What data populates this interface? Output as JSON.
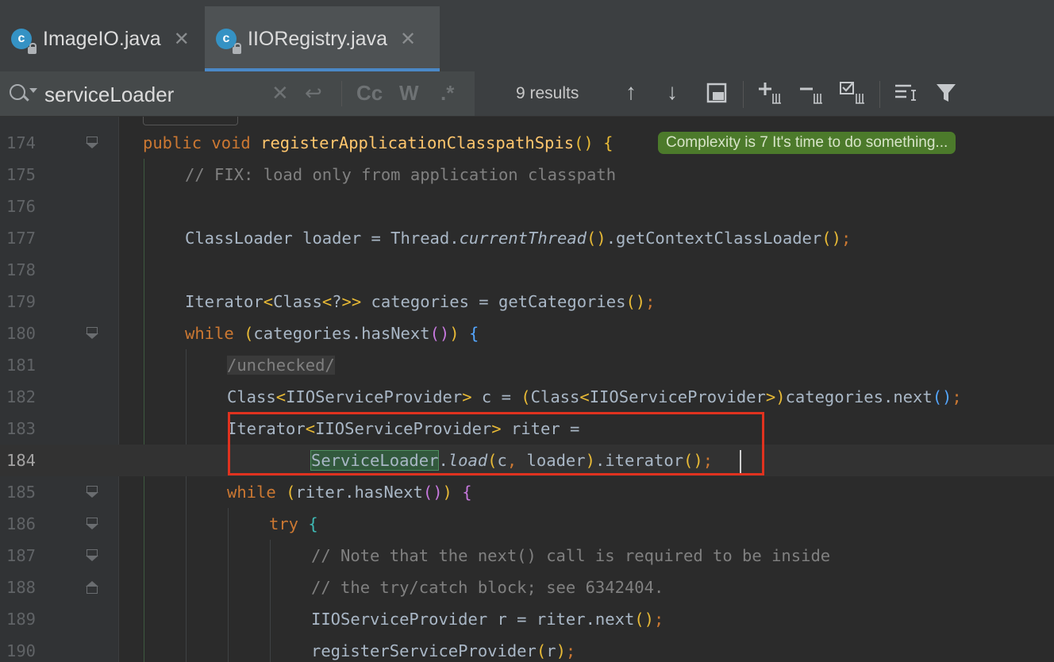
{
  "tabs": [
    {
      "label": "ImageIO.java",
      "icon": "java-class-icon",
      "close": "✕",
      "active": false
    },
    {
      "label": "IIORegistry.java",
      "icon": "java-class-icon",
      "close": "✕",
      "active": true
    }
  ],
  "find": {
    "query": "serviceLoader",
    "clear_glyph": "✕",
    "newline_glyph": "↩",
    "match_case_label": "Cc",
    "words_label": "W",
    "regex_label": ".*",
    "results_label": "9 results",
    "prev_glyph": "↑",
    "next_glyph": "↓"
  },
  "editor": {
    "complexity_hint": "Complexity is 7 It's time to do something...",
    "line_numbers": [
      "174",
      "175",
      "176",
      "177",
      "178",
      "179",
      "180",
      "181",
      "182",
      "183",
      "184",
      "185",
      "186",
      "187",
      "188",
      "189",
      "190"
    ],
    "code": {
      "l174_kw1": "public",
      "l174_kw2": "void",
      "l174_fn": "registerApplicationClasspathSpis",
      "l175": "// FIX: load only from application classpath",
      "l177_a": "ClassLoader loader = Thread.",
      "l177_it": "currentThread",
      "l177_b": ".getContextClassLoader",
      "l179_a": "Iterator",
      "l179_b": "Class",
      "l179_c": "?",
      "l179_d": " categories = getCategories",
      "l180_kw": "while",
      "l180_b": "categories.hasNext",
      "l181": "/unchecked/",
      "l182_a": "Class",
      "l182_b": "IIOServiceProvider",
      "l182_c": " c = ",
      "l182_d": "Class",
      "l182_e": "IIOServiceProvider",
      "l182_f": "categories.next",
      "l183_a": "Iterator",
      "l183_b": "IIOServiceProvider",
      "l183_c": " riter =",
      "l184_a": "ServiceLoader",
      "l184_b": ".",
      "l184_it": "load",
      "l184_c": "c",
      "l184_d": " loader",
      "l184_e": ".iterator",
      "l185_kw": "while",
      "l185_b": "riter.hasNext",
      "l186_kw": "try",
      "l187": "// Note that the next() call is required to be inside",
      "l188": "// the try/catch block; see 6342404.",
      "l189_a": "IIOServiceProvider r = riter.next",
      "l190_a": "registerServiceProvider",
      "l190_b": "r"
    }
  },
  "colors": {
    "keyword": "#cc7832",
    "method": "#ffc66d",
    "text": "#a9b7c6",
    "comment": "#808080",
    "highlight_box": "#e0321f",
    "match_bg": "#32593d"
  }
}
